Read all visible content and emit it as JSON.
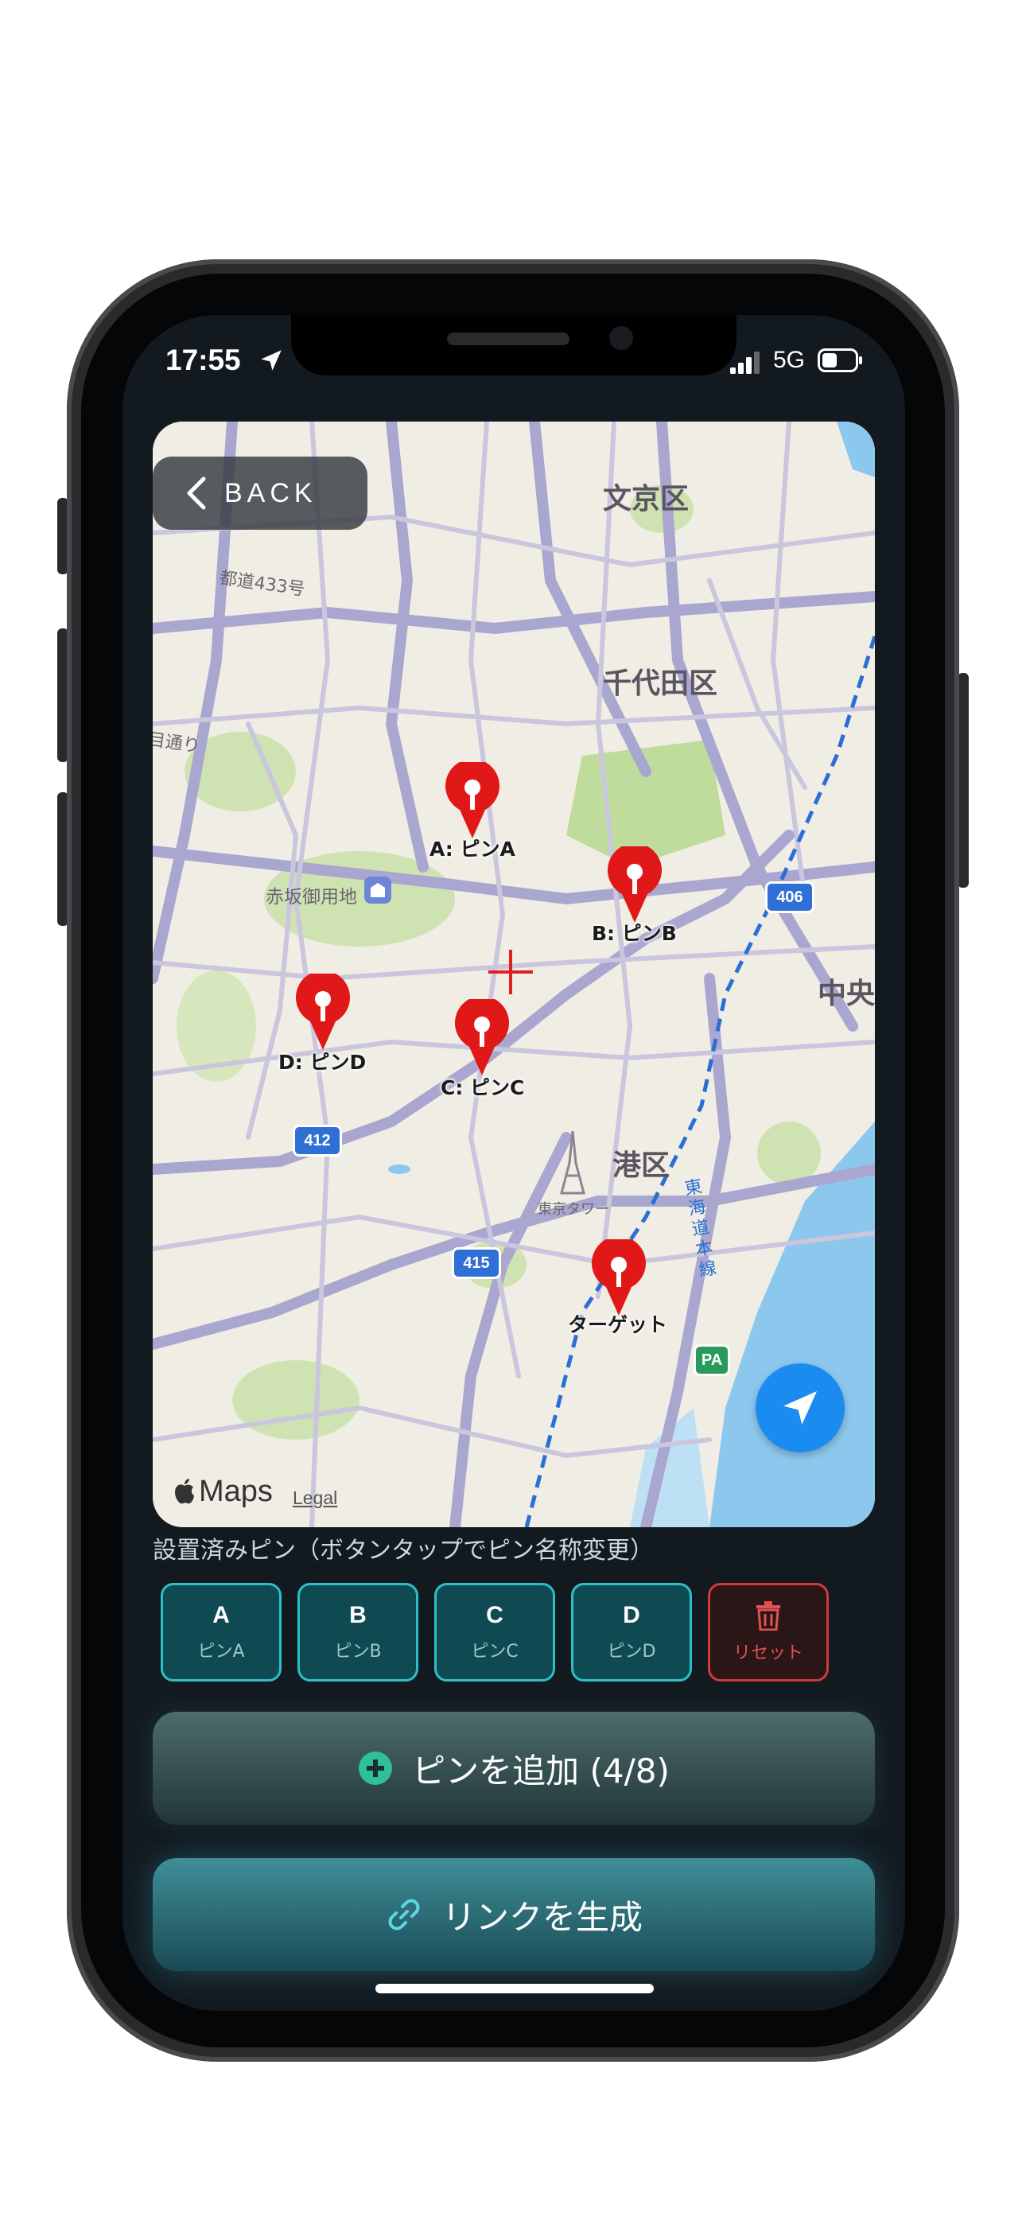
{
  "status_bar": {
    "time": "17:55",
    "network": "5G"
  },
  "map": {
    "back_label": "BACK",
    "districts": [
      "文京区",
      "千代田区",
      "港区",
      "中央"
    ],
    "minor_labels": [
      "都道433号",
      "赤坂御用地",
      "東京タワー",
      "目通り",
      "東海道本線"
    ],
    "routes": [
      "406",
      "412",
      "415"
    ],
    "pins": [
      {
        "label": "A: ピンA"
      },
      {
        "label": "B: ピンB"
      },
      {
        "label": "C: ピンC"
      },
      {
        "label": "D: ピンD"
      },
      {
        "label": "ターゲット"
      }
    ],
    "attribution": "Maps",
    "legal": "Legal",
    "pa_badge": "PA"
  },
  "pins_section": {
    "title": "設置済みピン（ボタンタップでピン名称変更）",
    "buttons": [
      {
        "key": "A",
        "name": "ピンA"
      },
      {
        "key": "B",
        "name": "ピンB"
      },
      {
        "key": "C",
        "name": "ピンC"
      },
      {
        "key": "D",
        "name": "ピンD"
      }
    ],
    "reset_label": "リセット"
  },
  "actions": {
    "add_pin_label": "ピンを追加 (4/8)",
    "generate_link_label": "リンクを生成"
  },
  "colors": {
    "accent": "#2ac0c9",
    "pin_red": "#e01818",
    "locate_blue": "#1a8cf0",
    "reset_red": "#d03a3a"
  }
}
